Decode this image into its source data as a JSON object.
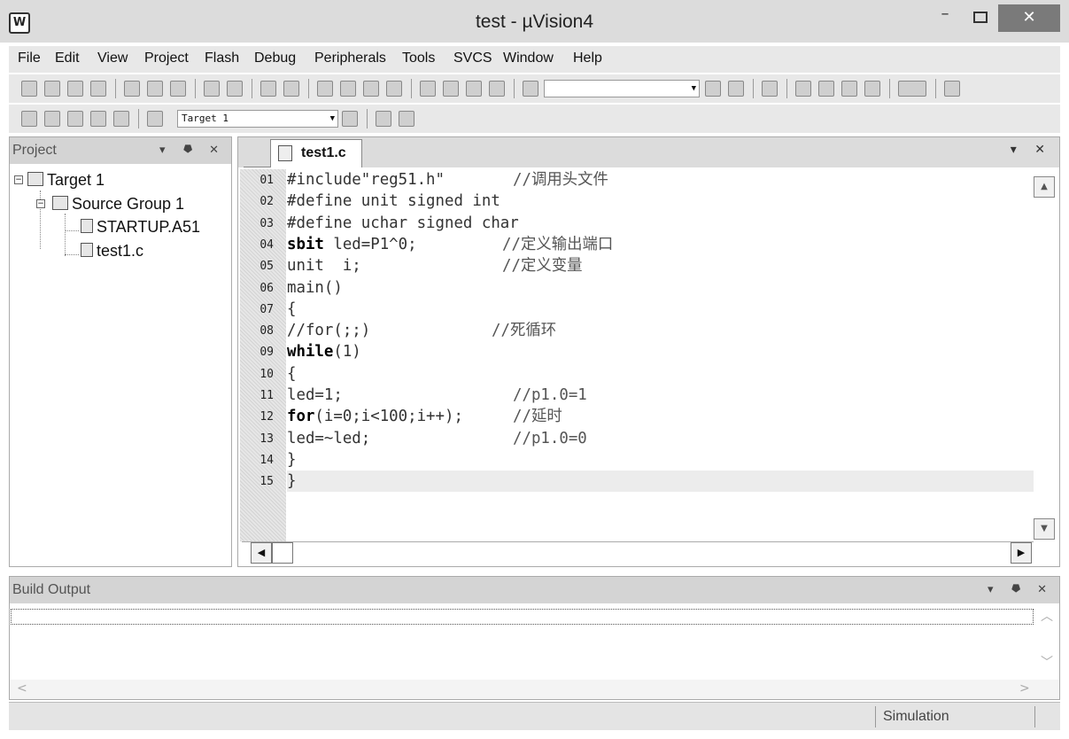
{
  "window": {
    "title": "test  - µVision4",
    "app_icon": "W",
    "min_glyph": "–",
    "close_glyph": "✕"
  },
  "menu": [
    "File",
    "Edit",
    "View",
    "Project",
    "Flash",
    "Debug",
    "Peripherals",
    "Tools",
    "SVCS",
    "Window",
    "Help"
  ],
  "toolbar2": {
    "target_combo": "Target 1"
  },
  "project_panel": {
    "title": "Project",
    "controls": "▾ ⯂ ✕",
    "tree": {
      "target": "Target 1",
      "group": "Source Group 1",
      "files": [
        "STARTUP.A51",
        "test1.c"
      ]
    }
  },
  "editor": {
    "tab": "test1.c",
    "controls": "▾ ✕",
    "lines": [
      {
        "no": "01",
        "code": "#include\"reg51.h\"",
        "comment": "//调用头文件"
      },
      {
        "no": "02",
        "code": "#define unit signed int",
        "comment": ""
      },
      {
        "no": "03",
        "code": "#define uchar signed char",
        "comment": ""
      },
      {
        "no": "04",
        "kw": "sbit",
        "code": " led=P1^0;",
        "comment": "//定义输出端口"
      },
      {
        "no": "05",
        "code": "unit  i;",
        "comment": "//定义变量"
      },
      {
        "no": "06",
        "code": "main()",
        "comment": ""
      },
      {
        "no": "07",
        "code": "{",
        "comment": ""
      },
      {
        "no": "08",
        "code": "//for(;;)",
        "comment": "//死循环"
      },
      {
        "no": "09",
        "kw": "while",
        "code": "(1)",
        "comment": ""
      },
      {
        "no": "10",
        "code": "{",
        "comment": ""
      },
      {
        "no": "11",
        "code": "led=1;",
        "comment": "//p1.0=1"
      },
      {
        "no": "12",
        "kw": "for",
        "code": "(i=0;i<100;i++);",
        "comment": "//延时"
      },
      {
        "no": "13",
        "code": "led=~led;",
        "comment": "//p1.0=0"
      },
      {
        "no": "14",
        "code": "}",
        "comment": ""
      },
      {
        "no": "15",
        "code": "}",
        "comment": ""
      }
    ]
  },
  "build_output": {
    "title": "Build Output",
    "controls": "▾ ⯂ ✕"
  },
  "status": {
    "mode": "Simulation"
  }
}
